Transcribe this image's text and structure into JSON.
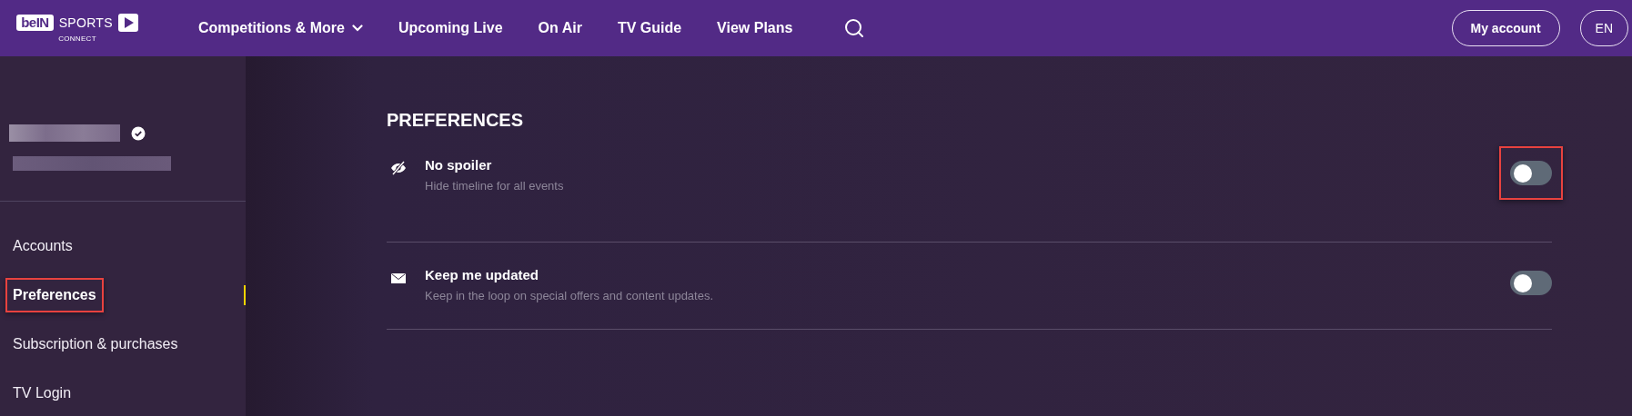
{
  "header": {
    "logo": {
      "brand": "beIN",
      "product": "SPORTS",
      "sub": "CONNECT"
    },
    "nav": [
      {
        "label": "Competitions & More",
        "kind": "dropdown"
      },
      {
        "label": "Upcoming Live",
        "kind": "link"
      },
      {
        "label": "On Air",
        "kind": "link"
      },
      {
        "label": "TV Guide",
        "kind": "link"
      },
      {
        "label": "View Plans",
        "kind": "link"
      }
    ],
    "account_button": "My account",
    "language_button": "EN"
  },
  "sidebar": {
    "profile": {
      "verified": true
    },
    "items": [
      {
        "label": "Accounts",
        "selected": false,
        "highlighted": false
      },
      {
        "label": "Preferences",
        "selected": true,
        "highlighted": true
      },
      {
        "label": "Subscription & purchases",
        "selected": false,
        "highlighted": false
      },
      {
        "label": "TV Login",
        "selected": false,
        "highlighted": false
      }
    ]
  },
  "preferences": {
    "title": "PREFERENCES",
    "settings": [
      {
        "kind": "spoiler",
        "title": "No spoiler",
        "description": "Hide timeline for all events",
        "on": false,
        "highlighted": true
      },
      {
        "kind": "mail",
        "title": "Keep me updated",
        "description": "Keep in the loop on special offers and content updates.",
        "on": false,
        "highlighted": false
      }
    ]
  }
}
